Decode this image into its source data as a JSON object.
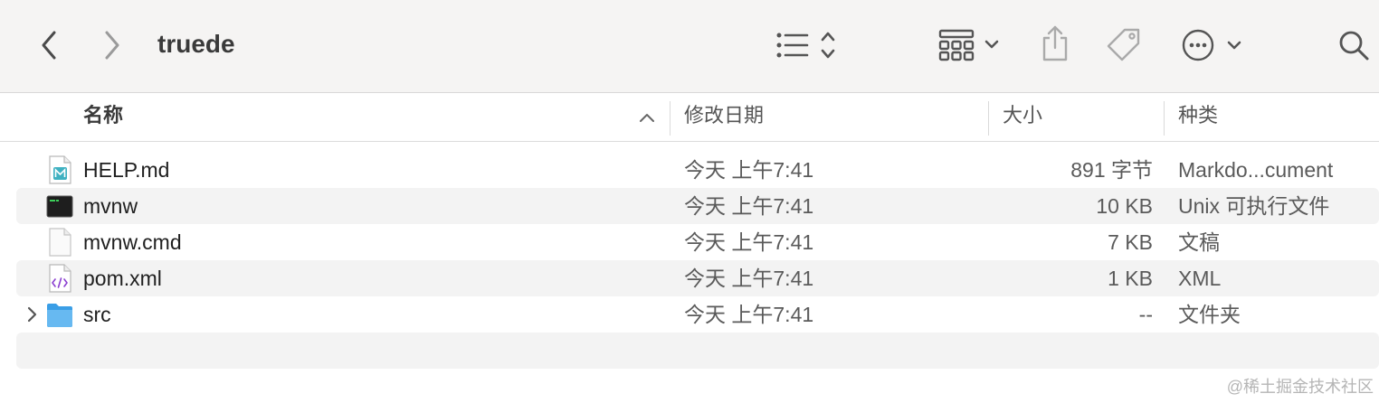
{
  "window": {
    "title": "truede"
  },
  "toolbar": {
    "back_icon": "chevron-left-icon",
    "forward_icon": "chevron-right-icon",
    "list_view_icon": "list-view-icon",
    "group_icon": "grid-group-icon",
    "share_icon": "share-icon",
    "tag_icon": "tag-icon",
    "more_icon": "ellipsis-circle-icon",
    "search_icon": "search-icon"
  },
  "columns": {
    "name": "名称",
    "date": "修改日期",
    "size": "大小",
    "kind": "种类"
  },
  "files": [
    {
      "name": "HELP.md",
      "date": "今天 上午7:41",
      "size": "891 字节",
      "kind": "Markdo...cument",
      "icon": "markdown-file-icon"
    },
    {
      "name": "mvnw",
      "date": "今天 上午7:41",
      "size": "10 KB",
      "kind": "Unix 可执行文件",
      "icon": "terminal-exec-icon"
    },
    {
      "name": "mvnw.cmd",
      "date": "今天 上午7:41",
      "size": "7 KB",
      "kind": "文稿",
      "icon": "document-file-icon"
    },
    {
      "name": "pom.xml",
      "date": "今天 上午7:41",
      "size": "1 KB",
      "kind": "XML",
      "icon": "xml-file-icon"
    },
    {
      "name": "src",
      "date": "今天 上午7:41",
      "size": "--",
      "kind": "文件夹",
      "icon": "folder-icon"
    }
  ],
  "watermark": "@稀土掘金技术社区",
  "colors": {
    "toolbar_bg": "#f5f4f3",
    "alt_row": "#f3f3f3",
    "folder": "#5fb4ee"
  }
}
